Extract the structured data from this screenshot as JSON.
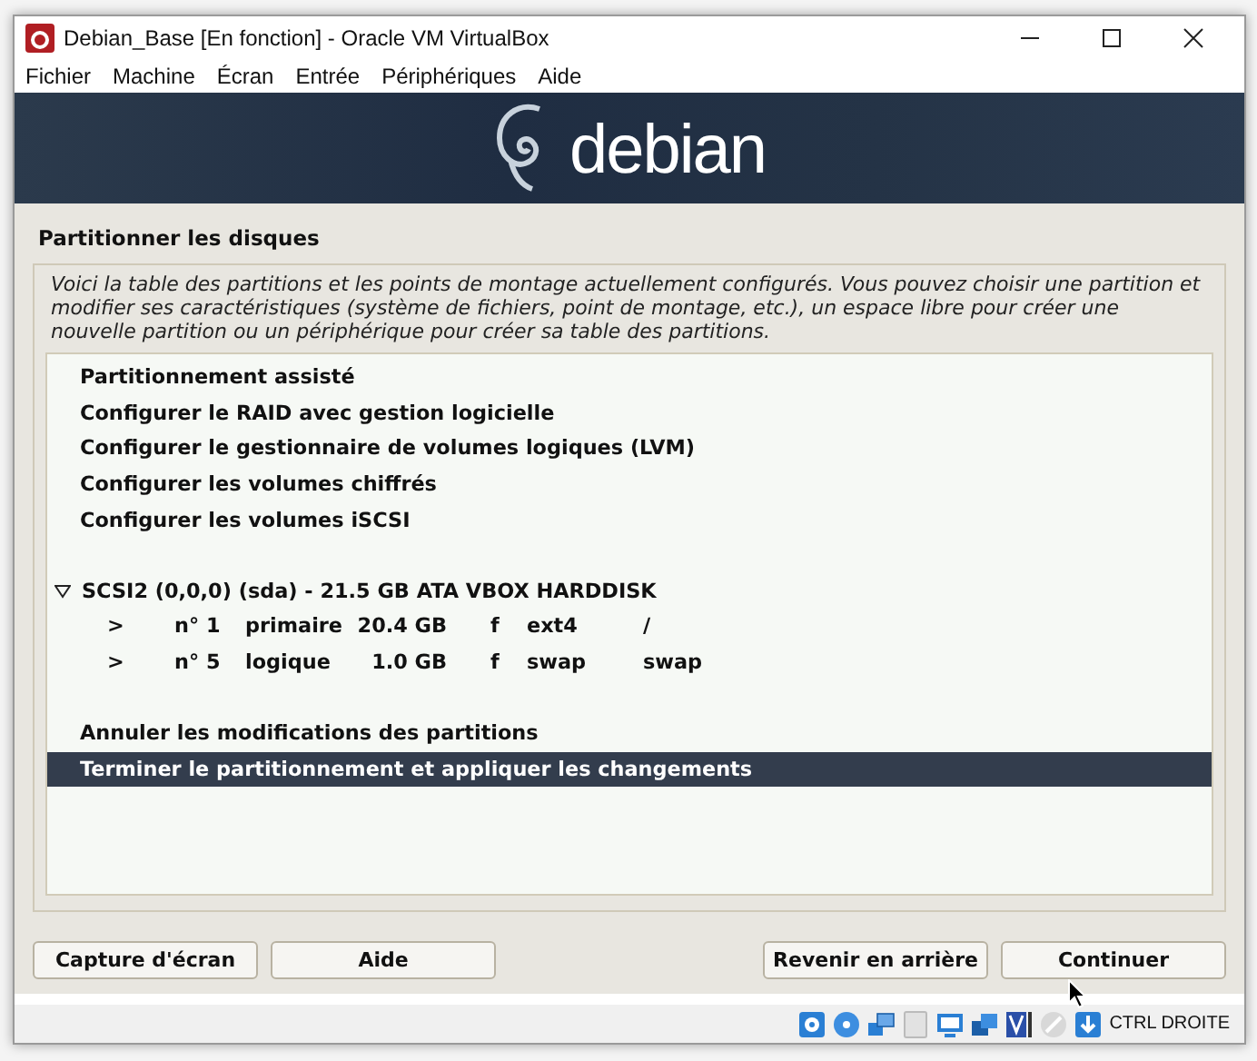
{
  "window": {
    "title": "Debian_Base [En fonction] - Oracle VM VirtualBox"
  },
  "menu": [
    "Fichier",
    "Machine",
    "Écran",
    "Entrée",
    "Périphériques",
    "Aide"
  ],
  "banner": {
    "logo_text": "debian"
  },
  "installer": {
    "title": "Partitionner les disques",
    "description": "Voici la table des partitions et les points de montage actuellement configurés. Vous pouvez choisir une partition et modifier ses caractéristiques (système de fichiers, point de montage, etc.), un espace libre pour créer une nouvelle partition ou un périphérique pour créer sa table des partitions.",
    "items": [
      {
        "kind": "action",
        "label": "Partitionnement assisté",
        "selected": false
      },
      {
        "kind": "action",
        "label": "Configurer le RAID avec gestion logicielle",
        "selected": false
      },
      {
        "kind": "action",
        "label": "Configurer le gestionnaire de volumes logiques (LVM)",
        "selected": false
      },
      {
        "kind": "action",
        "label": "Configurer les volumes chiffrés",
        "selected": false
      },
      {
        "kind": "action",
        "label": "Configurer les volumes iSCSI",
        "selected": false
      },
      {
        "kind": "gap"
      },
      {
        "kind": "disk",
        "label": "SCSI2 (0,0,0) (sda) - 21.5 GB ATA VBOX HARDDISK",
        "expanded": true,
        "selected": false,
        "children": [
          {
            "kind": "partition",
            "selected": false,
            "cells": [
              ">",
              "n° 1",
              "primaire",
              "20.4 GB",
              "f",
              "ext4",
              "/"
            ]
          },
          {
            "kind": "partition",
            "selected": false,
            "cells": [
              ">",
              "n° 5",
              "logique",
              "1.0 GB",
              "f",
              "swap",
              "swap"
            ]
          }
        ]
      },
      {
        "kind": "gap"
      },
      {
        "kind": "action",
        "label": "Annuler les modifications des partitions",
        "selected": false
      },
      {
        "kind": "action",
        "label": "Terminer le partitionnement et appliquer les changements",
        "selected": true
      }
    ],
    "buttons_left": [
      "Capture d'écran",
      "Aide"
    ],
    "buttons_right": [
      "Revenir en arrière",
      "Continuer"
    ]
  },
  "status_bar": {
    "host_key": "CTRL DROITE"
  }
}
